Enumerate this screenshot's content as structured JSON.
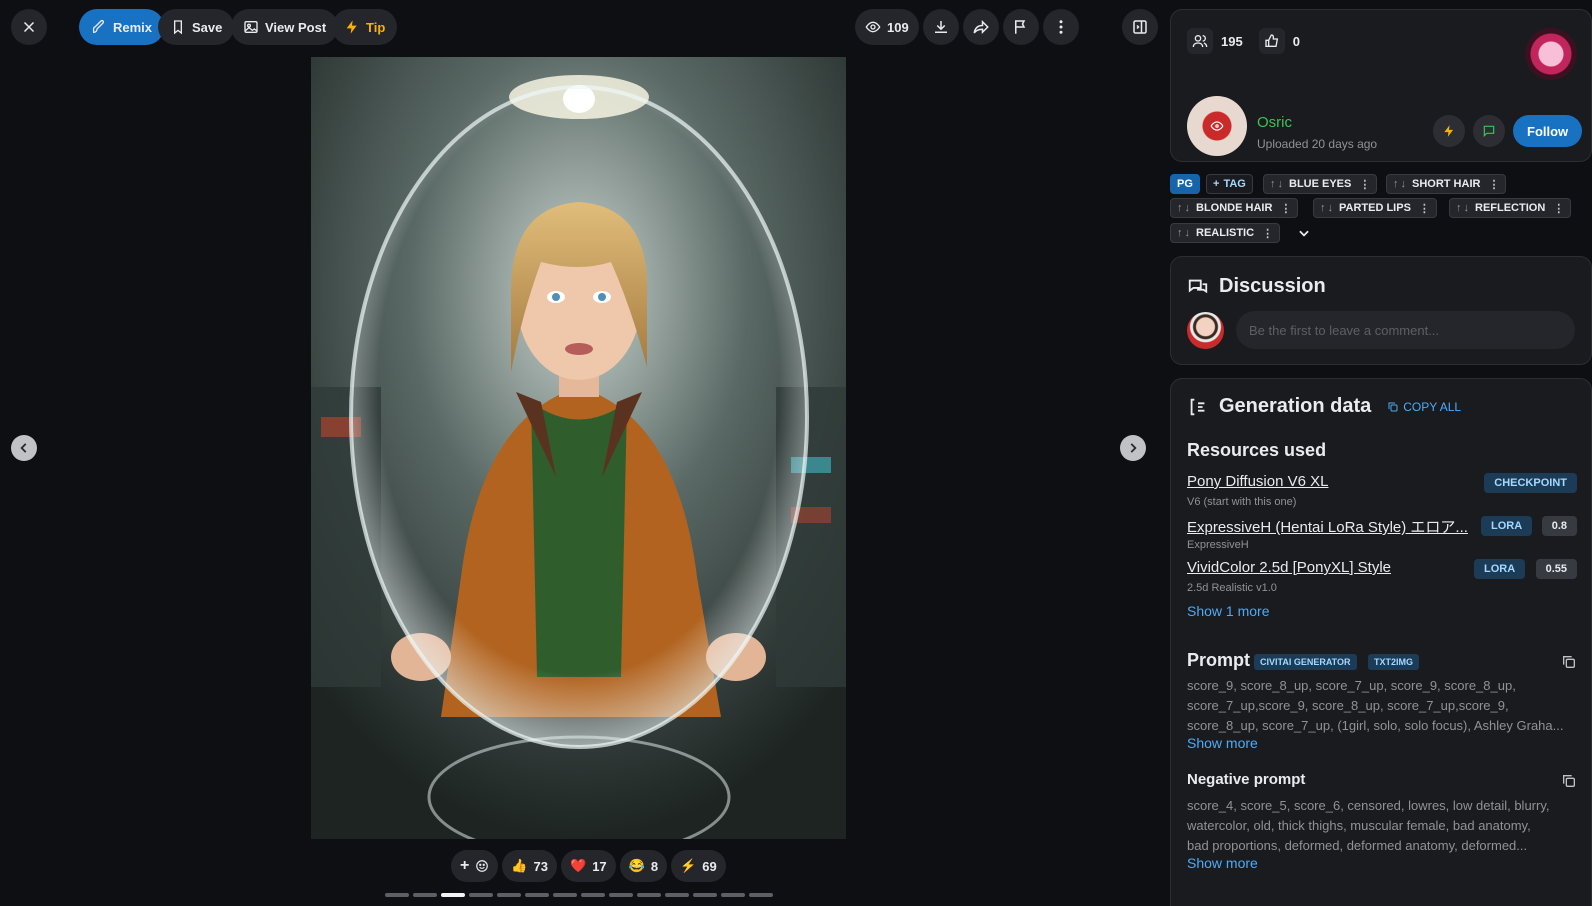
{
  "toolbar": {
    "remix": "Remix",
    "save": "Save",
    "view_post": "View Post",
    "tip": "Tip",
    "views": "109"
  },
  "reactions": [
    {
      "emoji": "👍",
      "count": "73"
    },
    {
      "emoji": "❤️",
      "count": "17"
    },
    {
      "emoji": "😂",
      "count": "8"
    },
    {
      "emoji": "⚡",
      "count": "69"
    }
  ],
  "carousel": {
    "count": 14,
    "active_index": 2
  },
  "author": {
    "followers": "195",
    "likes": "0",
    "name": "Osric",
    "uploaded": "Uploaded 20 days ago",
    "follow": "Follow"
  },
  "tags": {
    "rating": "PG",
    "add": "TAG",
    "items": [
      "BLUE EYES",
      "SHORT HAIR",
      "BLONDE HAIR",
      "PARTED LIPS",
      "REFLECTION",
      "REALISTIC"
    ]
  },
  "discussion": {
    "title": "Discussion",
    "placeholder": "Be the first to leave a comment..."
  },
  "generation": {
    "title": "Generation data",
    "copy_all": "COPY ALL",
    "resources_title": "Resources used",
    "resources": [
      {
        "name": "Pony Diffusion V6 XL",
        "sub": "V6 (start with this one)",
        "type": "CHECKPOINT",
        "weight": ""
      },
      {
        "name": "ExpressiveH (Hentai LoRa Style) エロア...",
        "sub": "ExpressiveH",
        "type": "LORA",
        "weight": "0.8"
      },
      {
        "name": "VividColor 2.5d [PonyXL] Style",
        "sub": "2.5d Realistic v1.0",
        "type": "LORA",
        "weight": "0.55"
      }
    ],
    "show_more_resources": "Show 1 more",
    "prompt_title": "Prompt",
    "prompt_badges": [
      "CIVITAI GENERATOR",
      "TXT2IMG"
    ],
    "prompt_lines": [
      "score_9, score_8_up, score_7_up, score_9, score_8_up,",
      "score_7_up,score_9, score_8_up, score_7_up,score_9,",
      "score_8_up, score_7_up, (1girl, solo, solo focus), Ashley Graha..."
    ],
    "show_more": "Show more",
    "negative_title": "Negative prompt",
    "negative_lines": [
      "score_4, score_5, score_6, censored, lowres, low detail, blurry,",
      "watercolor, old, thick thighs, muscular female, bad anatomy,",
      "bad proportions, deformed, deformed anatomy, deformed..."
    ],
    "show_more_negative": "Show more"
  }
}
